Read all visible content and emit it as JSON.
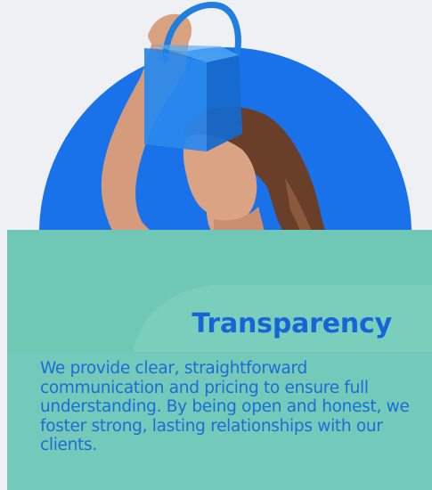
{
  "card": {
    "title": "Transparency",
    "description": "We provide clear, straightforward communication and pricing to ensure full understanding. By being open and honest, we foster strong, lasting relationships with our clients."
  },
  "image": {
    "subject": "woman-holding-blue-handbag",
    "colors": {
      "background": "#eef0f3",
      "arc": "#1a72ea",
      "card": "#6fc8b5",
      "title": "#1565d8",
      "text": "#1e6bd6",
      "bag": "#1f7ee0"
    }
  }
}
